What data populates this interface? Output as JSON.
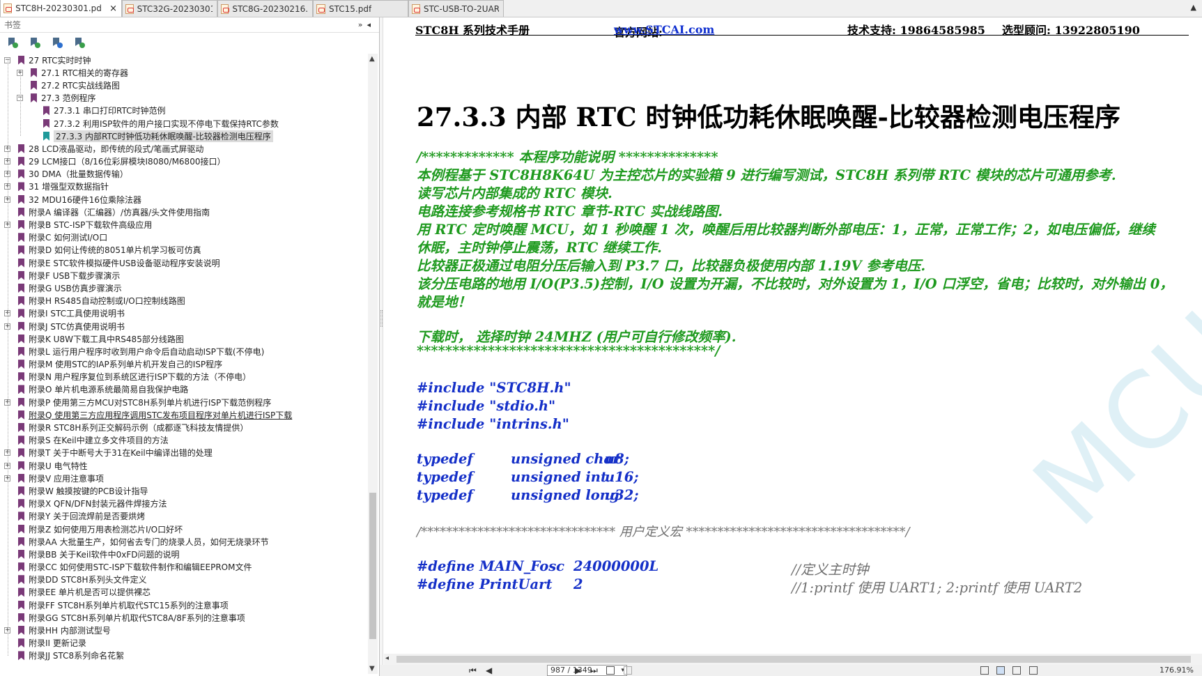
{
  "tabs": [
    {
      "label": "STC8H-20230301.pd...",
      "active": true
    },
    {
      "label": "STC32G-20230301...",
      "active": false
    },
    {
      "label": "STC8G-20230216.p...",
      "active": false
    },
    {
      "label": "STC15.pdf",
      "active": false
    },
    {
      "label": "STC-USB-TO-2UAR...",
      "active": false
    }
  ],
  "tab_close": "×",
  "tab_menu": "▲",
  "left_panel": {
    "title": "书签",
    "controls": "»◂"
  },
  "bookmarks": [
    {
      "label": "27 RTC实时时钟",
      "level": 0,
      "expander": "−"
    },
    {
      "label": "27.1 RTC相关的寄存器",
      "level": 1,
      "expander": "+"
    },
    {
      "label": "27.2 RTC实战线路图",
      "level": 1,
      "expander": ""
    },
    {
      "label": "27.3 范例程序",
      "level": 1,
      "expander": "−"
    },
    {
      "label": "27.3.1 串口打印RTC时钟范例",
      "level": 2,
      "expander": ""
    },
    {
      "label": "27.3.2 利用ISP软件的用户接口实现不停电下载保持RTC参数",
      "level": 2,
      "expander": ""
    },
    {
      "label": "27.3.3 内部RTC时钟低功耗休眠唤醒-比较器检测电压程序",
      "level": 2,
      "expander": "",
      "selected": true
    },
    {
      "label": "28 LCD液晶驱动，即传统的段式/笔画式屏驱动",
      "level": 0,
      "expander": "+"
    },
    {
      "label": "29 LCM接口（8/16位彩屏模块I8080/M6800接口）",
      "level": 0,
      "expander": "+"
    },
    {
      "label": "30 DMA（批量数据传输）",
      "level": 0,
      "expander": "+"
    },
    {
      "label": "31 增强型双数据指针",
      "level": 0,
      "expander": "+"
    },
    {
      "label": "32 MDU16硬件16位乘除法器",
      "level": 0,
      "expander": "+"
    },
    {
      "label": "附录A 编译器（汇编器）/仿真器/头文件使用指南",
      "level": 0,
      "expander": ""
    },
    {
      "label": "附录B STC-ISP下载软件高级应用",
      "level": 0,
      "expander": "+"
    },
    {
      "label": "附录C 如何测试I/O口",
      "level": 0,
      "expander": ""
    },
    {
      "label": "附录D 如何让传统的8051单片机学习板可仿真",
      "level": 0,
      "expander": ""
    },
    {
      "label": "附录E STC软件模拟硬件USB设备驱动程序安装说明",
      "level": 0,
      "expander": ""
    },
    {
      "label": "附录F USB下载步骤演示",
      "level": 0,
      "expander": ""
    },
    {
      "label": "附录G USB仿真步骤演示",
      "level": 0,
      "expander": ""
    },
    {
      "label": "附录H RS485自动控制或I/O口控制线路图",
      "level": 0,
      "expander": ""
    },
    {
      "label": "附录I STC工具使用说明书",
      "level": 0,
      "expander": "+"
    },
    {
      "label": "附录J STC仿真使用说明书",
      "level": 0,
      "expander": "+"
    },
    {
      "label": "附录K U8W下载工具中RS485部分线路图",
      "level": 0,
      "expander": ""
    },
    {
      "label": "附录L 运行用户程序时收到用户命令后自动启动ISP下载(不停电)",
      "level": 0,
      "expander": ""
    },
    {
      "label": "附录M 使用STC的IAP系列单片机开发自己的ISP程序",
      "level": 0,
      "expander": ""
    },
    {
      "label": "附录N 用户程序复位到系统区进行ISP下载的方法（不停电）",
      "level": 0,
      "expander": ""
    },
    {
      "label": "附录O 单片机电源系统最简易自我保护电路",
      "level": 0,
      "expander": ""
    },
    {
      "label": "附录P 使用第三方MCU对STC8H系列单片机进行ISP下载范例程序",
      "level": 0,
      "expander": "+"
    },
    {
      "label": "附录Q 使用第三方应用程序调用STC发布项目程序对单片机进行ISP下载",
      "level": 0,
      "expander": "",
      "underline": true
    },
    {
      "label": "附录R STC8H系列正交解码示例（成都逐飞科技友情提供）",
      "level": 0,
      "expander": ""
    },
    {
      "label": "附录S 在Keil中建立多文件项目的方法",
      "level": 0,
      "expander": ""
    },
    {
      "label": "附录T 关于中断号大于31在Keil中编译出错的处理",
      "level": 0,
      "expander": "+"
    },
    {
      "label": "附录U 电气特性",
      "level": 0,
      "expander": "+"
    },
    {
      "label": "附录V 应用注意事项",
      "level": 0,
      "expander": "+"
    },
    {
      "label": "附录W 触摸按键的PCB设计指导",
      "level": 0,
      "expander": ""
    },
    {
      "label": "附录X QFN/DFN封装元器件焊接方法",
      "level": 0,
      "expander": ""
    },
    {
      "label": "附录Y 关于回流焊前是否要烘烤",
      "level": 0,
      "expander": ""
    },
    {
      "label": "附录Z 如何使用万用表检测芯片I/O口好坏",
      "level": 0,
      "expander": ""
    },
    {
      "label": "附录AA 大批量生产，如何省去专门的烧录人员，如何无烧录环节",
      "level": 0,
      "expander": ""
    },
    {
      "label": "附录BB 关于Keil软件中0xFD问题的说明",
      "level": 0,
      "expander": ""
    },
    {
      "label": "附录CC 如何使用STC-ISP下载软件制作和编辑EEPROM文件",
      "level": 0,
      "expander": ""
    },
    {
      "label": "附录DD STC8H系列头文件定义",
      "level": 0,
      "expander": ""
    },
    {
      "label": "附录EE 单片机是否可以提供裸芯",
      "level": 0,
      "expander": ""
    },
    {
      "label": "附录FF STC8H系列单片机取代STC15系列的注意事项",
      "level": 0,
      "expander": ""
    },
    {
      "label": "附录GG STC8H系列单片机取代STC8A/8F系列的注意事项",
      "level": 0,
      "expander": ""
    },
    {
      "label": "附录HH 内部测试型号",
      "level": 0,
      "expander": "+"
    },
    {
      "label": "附录II 更新记录",
      "level": 0,
      "expander": ""
    },
    {
      "label": "附录JJ STC8系列命名花絮",
      "level": 0,
      "expander": ""
    }
  ],
  "doc": {
    "header_manual": "STC8H 系列技术手册",
    "header_site_label": "官方网站: ",
    "header_site_url": "www.STCAI.com",
    "header_support": "技术支持: 19864585985",
    "header_consult": "选型顾问: 13922805190",
    "section_title": "27.3.3  内部 RTC 时钟低功耗休眠唤醒-比较器检测电压程序",
    "lines": [
      {
        "text": "/*************  本程序功能说明  **************",
        "color": "green"
      },
      {
        "text": "本例程基于 STC8H8K64U 为主控芯片的实验箱 9 进行编写测试，STC8H 系列带 RTC 模块的芯片可通用参考.",
        "color": "green"
      },
      {
        "text": "读写芯片内部集成的 RTC 模块.",
        "color": "green"
      },
      {
        "text": "电路连接参考规格书 RTC 章节-RTC 实战线路图.",
        "color": "green"
      },
      {
        "text": "用 RTC 定时唤醒 MCU，如 1 秒唤醒 1 次，唤醒后用比较器判断外部电压：1，正常，正常工作；2，如电压偏低，继续",
        "color": "green"
      },
      {
        "text": "休眠，主时钟停止震荡，RTC 继续工作.",
        "color": "green"
      },
      {
        "text": "比较器正极通过电阻分压后输入到 P3.7 口，比较器负极使用内部 1.19V 参考电压.",
        "color": "green"
      },
      {
        "text": "该分压电路的地用 I/O(P3.5)控制，I/O 设置为开漏，不比较时，对外设置为 1，I/O 口浮空，省电；比较时，对外输出 0，",
        "color": "green"
      },
      {
        "text": "就是地！",
        "color": "green"
      },
      {
        "text": "下载时，  选择时钟 24MHZ (用户可自行修改频率).",
        "color": "green"
      },
      {
        "text": "******************************************/",
        "color": "green"
      },
      {
        "text": "#include \"STC8H.h\"",
        "color": "blue"
      },
      {
        "text": "#include \"stdio.h\"",
        "color": "blue"
      },
      {
        "text": "#include \"intrins.h\"",
        "color": "blue"
      }
    ],
    "typedefs": [
      {
        "kw": "typedef",
        "type": "unsigned char",
        "name": "u8;"
      },
      {
        "kw": "typedef",
        "type": "unsigned int",
        "name": "u16;"
      },
      {
        "kw": "typedef",
        "type": "unsigned long",
        "name": "u32;"
      }
    ],
    "macro_banner": "/*******************************  用户定义宏  ***********************************/",
    "defines": [
      {
        "kw": "#define",
        "name": "MAIN_Fosc",
        "value": "24000000L",
        "comment": "//定义主时钟"
      },
      {
        "kw": "#define",
        "name": "PrintUart",
        "value": "2",
        "comment": "//1:printf  使用  UART1; 2:printf  使用 UART2"
      }
    ],
    "watermark": "MCU"
  },
  "status": {
    "page": "987 / 1349",
    "zoom": "176.91%",
    "first": "⏮",
    "prev": "◀",
    "next": "▶",
    "last": "⏭",
    "dropdown": "▾"
  },
  "colors": {
    "green": "#1f9a1f",
    "blue": "#1530c8",
    "bookmark": "#7a3a78",
    "bookmark_selected": "#1f9a9a"
  }
}
